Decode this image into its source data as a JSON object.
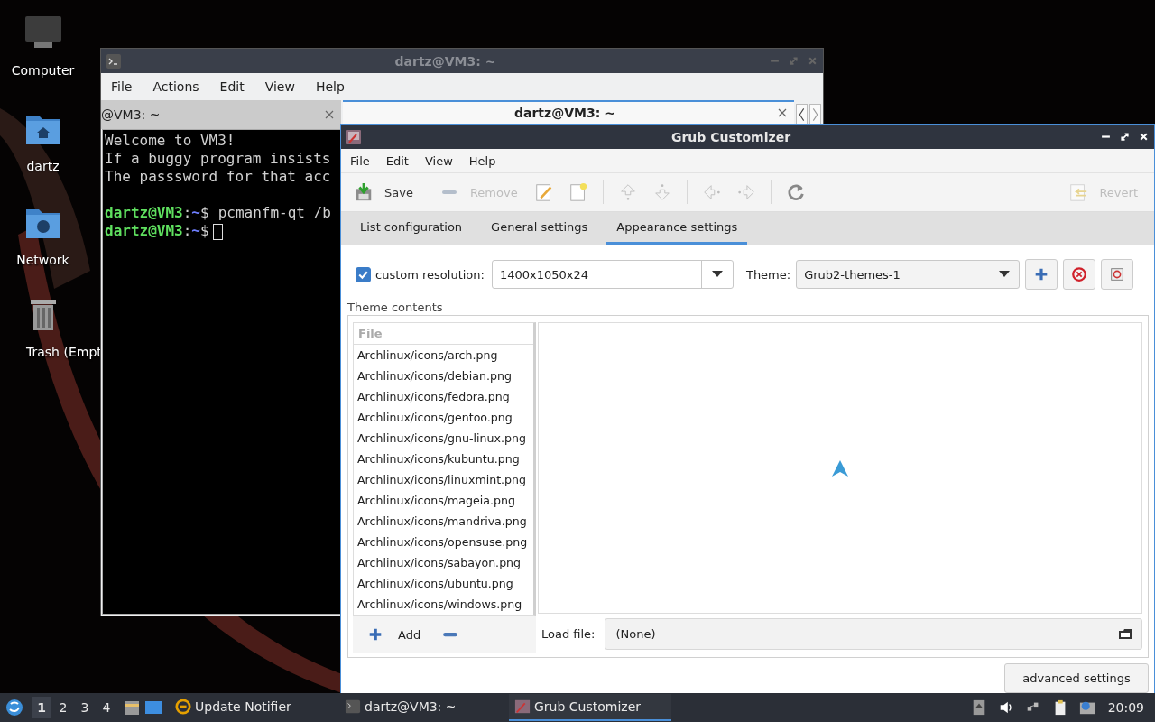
{
  "desktop_icons": [
    {
      "label": "Computer",
      "kind": "computer"
    },
    {
      "label": "dartz",
      "kind": "home"
    },
    {
      "label": "Network",
      "kind": "network"
    },
    {
      "label": "Trash (Empt",
      "kind": "trash"
    }
  ],
  "terminal": {
    "title": "dartz@VM3: ~",
    "menu": [
      "File",
      "Actions",
      "Edit",
      "View",
      "Help"
    ],
    "tabs": [
      {
        "label": "@VM3: ~",
        "selected": false
      },
      {
        "label": "dartz@VM3: ~",
        "selected": true
      }
    ],
    "messages": [
      "Welcome to VM3!",
      "If a buggy program insists",
      "The passsword for that acc"
    ],
    "prompts": [
      {
        "user": "dartz@VM3",
        "sep": ":",
        "path": "~",
        "sign": "$",
        "command": "pcmanfm-qt /b",
        "cursor": false
      },
      {
        "user": "dartz@VM3",
        "sep": ":",
        "path": "~",
        "sign": "$",
        "cursor": true
      }
    ]
  },
  "grub": {
    "title": "Grub Customizer",
    "menu": [
      "File",
      "Edit",
      "View",
      "Help"
    ],
    "toolbar": [
      [
        {
          "kind": "save",
          "label": "Save",
          "disabled": false
        }
      ],
      [
        {
          "kind": "remove",
          "label": "Remove",
          "disabled": true
        },
        {
          "kind": "edit",
          "disabled": false
        },
        {
          "kind": "new",
          "disabled": false
        }
      ],
      [
        {
          "kind": "up",
          "disabled": true
        },
        {
          "kind": "down",
          "disabled": true
        }
      ],
      [
        {
          "kind": "left",
          "disabled": true
        },
        {
          "kind": "right",
          "disabled": true
        }
      ],
      [
        {
          "kind": "refresh",
          "disabled": false
        }
      ]
    ],
    "revert": {
      "label": "Revert",
      "disabled": true
    },
    "tabs": [
      {
        "label": "List configuration",
        "selected": false
      },
      {
        "label": "General settings",
        "selected": false
      },
      {
        "label": "Appearance settings",
        "selected": true
      }
    ],
    "custom_resolution": {
      "label": "custom resolution:",
      "checked": true,
      "value": "1400x1050x24"
    },
    "theme": {
      "label": "Theme:",
      "value": "Grub2-themes-1",
      "buttons": [
        {
          "kind": "add"
        },
        {
          "kind": "remove"
        },
        {
          "kind": "extract"
        }
      ]
    },
    "theme_contents": {
      "label": "Theme contents",
      "header": "File",
      "files": [
        "Archlinux/icons/arch.png",
        "Archlinux/icons/debian.png",
        "Archlinux/icons/fedora.png",
        "Archlinux/icons/gentoo.png",
        "Archlinux/icons/gnu-linux.png",
        "Archlinux/icons/kubuntu.png",
        "Archlinux/icons/linuxmint.png",
        "Archlinux/icons/mageia.png",
        "Archlinux/icons/mandriva.png",
        "Archlinux/icons/opensuse.png",
        "Archlinux/icons/sabayon.png",
        "Archlinux/icons/ubuntu.png",
        "Archlinux/icons/windows.png"
      ],
      "add_label": "Add",
      "load_file_label": "Load file:",
      "load_file_value": "(None)"
    },
    "advanced_button": "advanced settings"
  },
  "taskbar": {
    "workspaces": [
      {
        "label": "1",
        "selected": true
      },
      {
        "label": "2",
        "selected": false
      },
      {
        "label": "3",
        "selected": false
      },
      {
        "label": "4",
        "selected": false
      }
    ],
    "quicklaunch": [
      {
        "kind": "files"
      },
      {
        "kind": "desktop"
      }
    ],
    "tasks": [
      {
        "kind": "notifier",
        "label": "Update Notifier",
        "selected": false
      },
      {
        "kind": "terminal",
        "label": "dartz@VM3: ~",
        "selected": false
      },
      {
        "kind": "grub",
        "label": "Grub Customizer",
        "selected": true
      }
    ],
    "tray": [
      {
        "kind": "eject"
      },
      {
        "kind": "volume"
      },
      {
        "kind": "network"
      },
      {
        "kind": "clipboard"
      },
      {
        "kind": "notice"
      }
    ],
    "clock": "20:09"
  }
}
